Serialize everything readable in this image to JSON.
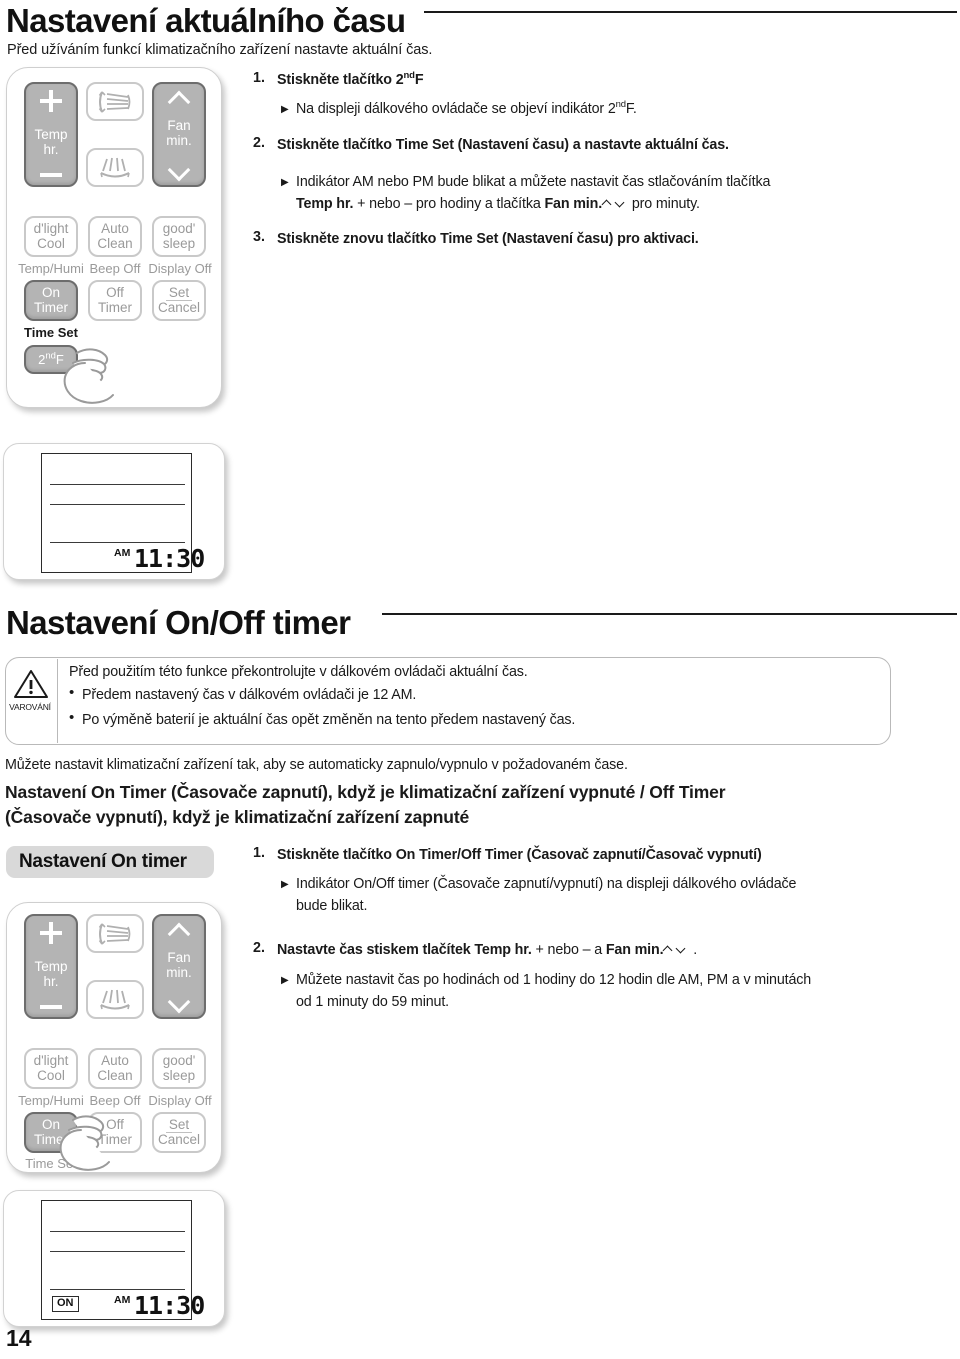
{
  "page": {
    "number": "14"
  },
  "section1": {
    "title": "Nastavení aktuálního času",
    "subtitle": "Před užíváním funkcí klimatizačního zařízení nastavte aktuální čas.",
    "steps": [
      {
        "number": "1.",
        "text_parts": [
          "Stiskněte tlačítko 2",
          "nd",
          "F"
        ],
        "bullets": [
          {
            "parts": [
              "Na displeji dálkového ovládače se objeví indikátor 2",
              "nd",
              "F."
            ]
          }
        ]
      },
      {
        "number": "2.",
        "text_parts": [
          "Stiskněte tlačítko ",
          "Time Set",
          " (Nastavení času) a nastavte aktuální čas."
        ],
        "bullets": [
          {
            "line1": "Indikátor AM nebo PM bude blikat a můžete nastavit čas stlačováním tlačítka"
          },
          {
            "line2_a": "Temp hr.",
            "line2_b": " + nebo – pro hodiny a tlačítka ",
            "line2_c": "Fan min.",
            "line2_d": " pro minuty."
          }
        ]
      },
      {
        "number": "3.",
        "text_parts": [
          "Stiskněte znovu tlačítko ",
          "Time Set",
          " (Nastavení času) pro aktivaci."
        ]
      }
    ]
  },
  "section2": {
    "title": "Nastavení On/Off timer",
    "warning": {
      "label": "VAROVÁNÍ",
      "icon": "warning-triangle-icon",
      "lines": [
        "Před použitím této funkce překontrolujte v dálkovém ovládači aktuální čas.",
        "Předem nastavený čas v dálkovém ovládači je 12 AM.",
        "Po výměně baterií je aktuální čas opět změněn na tento předem nastavený čas."
      ]
    },
    "intro": "Můžete nastavit klimatizační zařízení tak, aby se automaticky zapnulo/vypnulo v požadovaném čase.",
    "bold_heading_line1": "Nastavení On Timer (Časovače zapnutí), když je klimatizační zařízení vypnuté / Off Timer",
    "bold_heading_line2": "(Časovače vypnutí), když je klimatizační zařízení zapnuté",
    "pill_label": "Nastavení On timer",
    "steps": [
      {
        "number": "1.",
        "text": "Stiskněte tlačítko On Timer/Off Timer (Časovač zapnutí/Časovač vypnutí)",
        "bullet_line1": "Indikátor On/Off timer (Časovače zapnutí/vypnutí) na displeji dálkového ovládače",
        "bullet_line2": "bude blikat."
      },
      {
        "number": "2.",
        "text_a": "Nastavte čas stiskem tlačítek ",
        "text_b": "Temp hr.",
        "text_c": " + nebo – a ",
        "text_d": "Fan min.",
        "text_e": " .",
        "bullet_line1": "Můžete nastavit čas po hodinách od 1 hodiny do 12 hodin dle AM, PM a v minutách",
        "bullet_line2": "od 1 minuty do 59 minut."
      }
    ]
  },
  "remote": {
    "buttons": {
      "temp_line1": "Temp",
      "temp_line2": "hr.",
      "fan_line1": "Fan",
      "fan_line2": "min.",
      "dlight_line1": "d'light",
      "dlight_line2": "Cool",
      "dlight_sub": "Temp/Humi",
      "autoclean_line1": "Auto",
      "autoclean_line2": "Clean",
      "autoclean_sub": "Beep Off",
      "goodsleep_line1": "good'",
      "goodsleep_line2": "sleep",
      "goodsleep_sub": "Display Off",
      "ontimer_line1": "On",
      "ontimer_line2": "Timer",
      "ontimer_sub": "Time Set",
      "offtimer_line1": "Off",
      "offtimer_line2": "Timer",
      "setcancel_line1": "Set",
      "setcancel_line2": "Cancel",
      "secondf_a": "2",
      "secondf_b": "nd",
      "secondf_c": "F"
    },
    "icons": {
      "vane_vertical": "vane-vertical-icon",
      "vane_horizontal": "vane-horizontal-icon",
      "hand": "hand-pointer-icon"
    }
  },
  "lcd": {
    "am_label": "AM",
    "time": "11:30",
    "on_indicator": "ON"
  },
  "colors": {
    "button_dark": "#b4b4b4",
    "button_dark_border": "#6d6d6d",
    "button_light_border": "#c9c9c9",
    "light_text": "#9a9a9a",
    "pill_bg": "#d9d9d9",
    "text": "#1a1a1a"
  }
}
